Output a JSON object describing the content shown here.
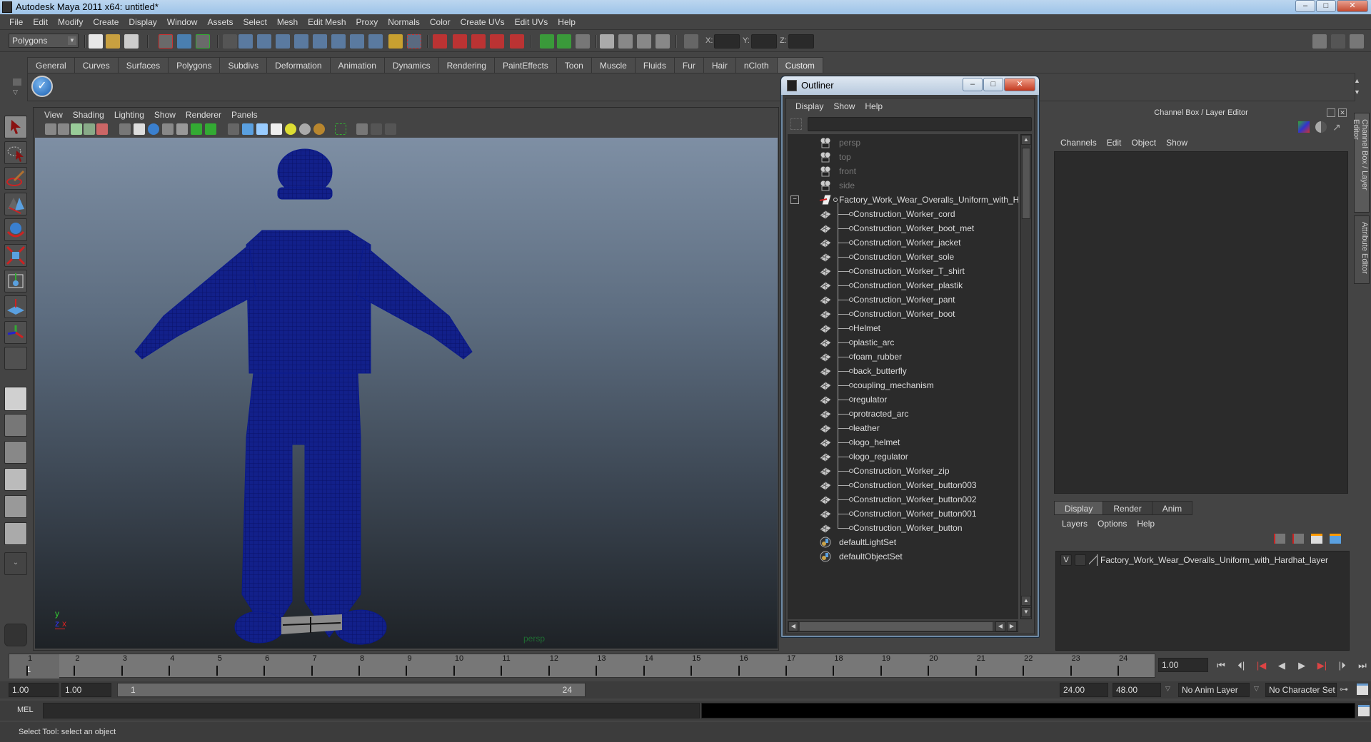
{
  "window": {
    "title": "Autodesk Maya 2011 x64: untitled*",
    "controls": {
      "minimize": "–",
      "maximize": "□",
      "close": "✕"
    }
  },
  "menubar": [
    "File",
    "Edit",
    "Modify",
    "Create",
    "Display",
    "Window",
    "Assets",
    "Select",
    "Mesh",
    "Edit Mesh",
    "Proxy",
    "Normals",
    "Color",
    "Create UVs",
    "Edit UVs",
    "Help"
  ],
  "toolbar": {
    "menu_set": "Polygons",
    "xyz_labels": {
      "x": "X:",
      "y": "Y:",
      "z": "Z:"
    },
    "xyz_values": {
      "x": "",
      "y": "",
      "z": ""
    }
  },
  "shelf": {
    "tabs": [
      "General",
      "Curves",
      "Surfaces",
      "Polygons",
      "Subdivs",
      "Deformation",
      "Animation",
      "Dynamics",
      "Rendering",
      "PaintEffects",
      "Toon",
      "Muscle",
      "Fluids",
      "Fur",
      "Hair",
      "nCloth",
      "Custom"
    ],
    "active_tab": "Custom",
    "items": [
      {
        "icon": "checkmark-icon"
      }
    ]
  },
  "tools": [
    "select-tool",
    "lasso-tool",
    "paint-select-tool",
    "move-tool",
    "rotate-tool",
    "scale-tool",
    "universal-manipulator",
    "soft-modification-tool",
    "show-manipulator-tool",
    "last-tool-slot"
  ],
  "layout_presets": [
    "single-perspective",
    "four-view",
    "outliner-persp",
    "persp-graph",
    "hypershade-persp",
    "persp-graph-outliner",
    "more-layouts"
  ],
  "viewport": {
    "menu": [
      "View",
      "Shading",
      "Lighting",
      "Show",
      "Renderer",
      "Panels"
    ],
    "camera_label": "persp",
    "axis": {
      "y": "y",
      "z": "z",
      "x": "x"
    },
    "wire_color": "#0a1a8c"
  },
  "outliner": {
    "title": "Outliner",
    "menu": [
      "Display",
      "Show",
      "Help"
    ],
    "filter_value": "",
    "cameras": [
      "persp",
      "top",
      "front",
      "side"
    ],
    "group": "Factory_Work_Wear_Overalls_Uniform_with_Hardhat",
    "children": [
      "Construction_Worker_cord",
      "Construction_Worker_boot_met",
      "Construction_Worker_jacket",
      "Construction_Worker_sole",
      "Construction_Worker_T_shirt",
      "Construction_Worker_plastik",
      "Construction_Worker_pant",
      "Construction_Worker_boot",
      "Helmet",
      "plastic_arc",
      "foam_rubber",
      "back_butterfly",
      "coupling_mechanism",
      "regulator",
      "protracted_arc",
      "leather",
      "logo_helmet",
      "logo_regulator",
      "Construction_Worker_zip",
      "Construction_Worker_button003",
      "Construction_Worker_button002",
      "Construction_Worker_button001",
      "Construction_Worker_button"
    ],
    "sets": [
      "defaultLightSet",
      "defaultObjectSet"
    ]
  },
  "channel_box": {
    "title": "Channel Box / Layer Editor",
    "menu": [
      "Channels",
      "Edit",
      "Object",
      "Show"
    ]
  },
  "layer_editor": {
    "tabs": [
      "Display",
      "Render",
      "Anim"
    ],
    "active_tab": "Display",
    "menu": [
      "Layers",
      "Options",
      "Help"
    ],
    "layers": [
      {
        "visible": "V",
        "name": "Factory_Work_Wear_Overalls_Uniform_with_Hardhat_layer"
      }
    ]
  },
  "side_tabs": [
    "Channel Box / Layer Editor",
    "Attribute Editor"
  ],
  "timeline": {
    "start": 1,
    "end": 24,
    "current_frame": 1,
    "ticks": [
      1,
      2,
      3,
      4,
      5,
      6,
      7,
      8,
      9,
      10,
      11,
      12,
      13,
      14,
      15,
      16,
      17,
      18,
      19,
      20,
      21,
      22,
      23,
      24
    ],
    "current_frame_field": "1.00"
  },
  "playback": [
    "go-to-start",
    "step-back-frame",
    "step-back-key",
    "play-backwards",
    "play-forwards",
    "step-forward-key",
    "step-forward-frame",
    "go-to-end"
  ],
  "range": {
    "start_time": "1.00",
    "playback_start": "1.00",
    "slider_start": "1",
    "slider_end": "24",
    "playback_end": "24.00",
    "end_time": "48.00",
    "anim_layer": "No Anim Layer",
    "character_set": "No Character Set"
  },
  "command_line": {
    "label": "MEL",
    "value": "",
    "output": ""
  },
  "status": {
    "help_line": "Select Tool: select an object"
  }
}
